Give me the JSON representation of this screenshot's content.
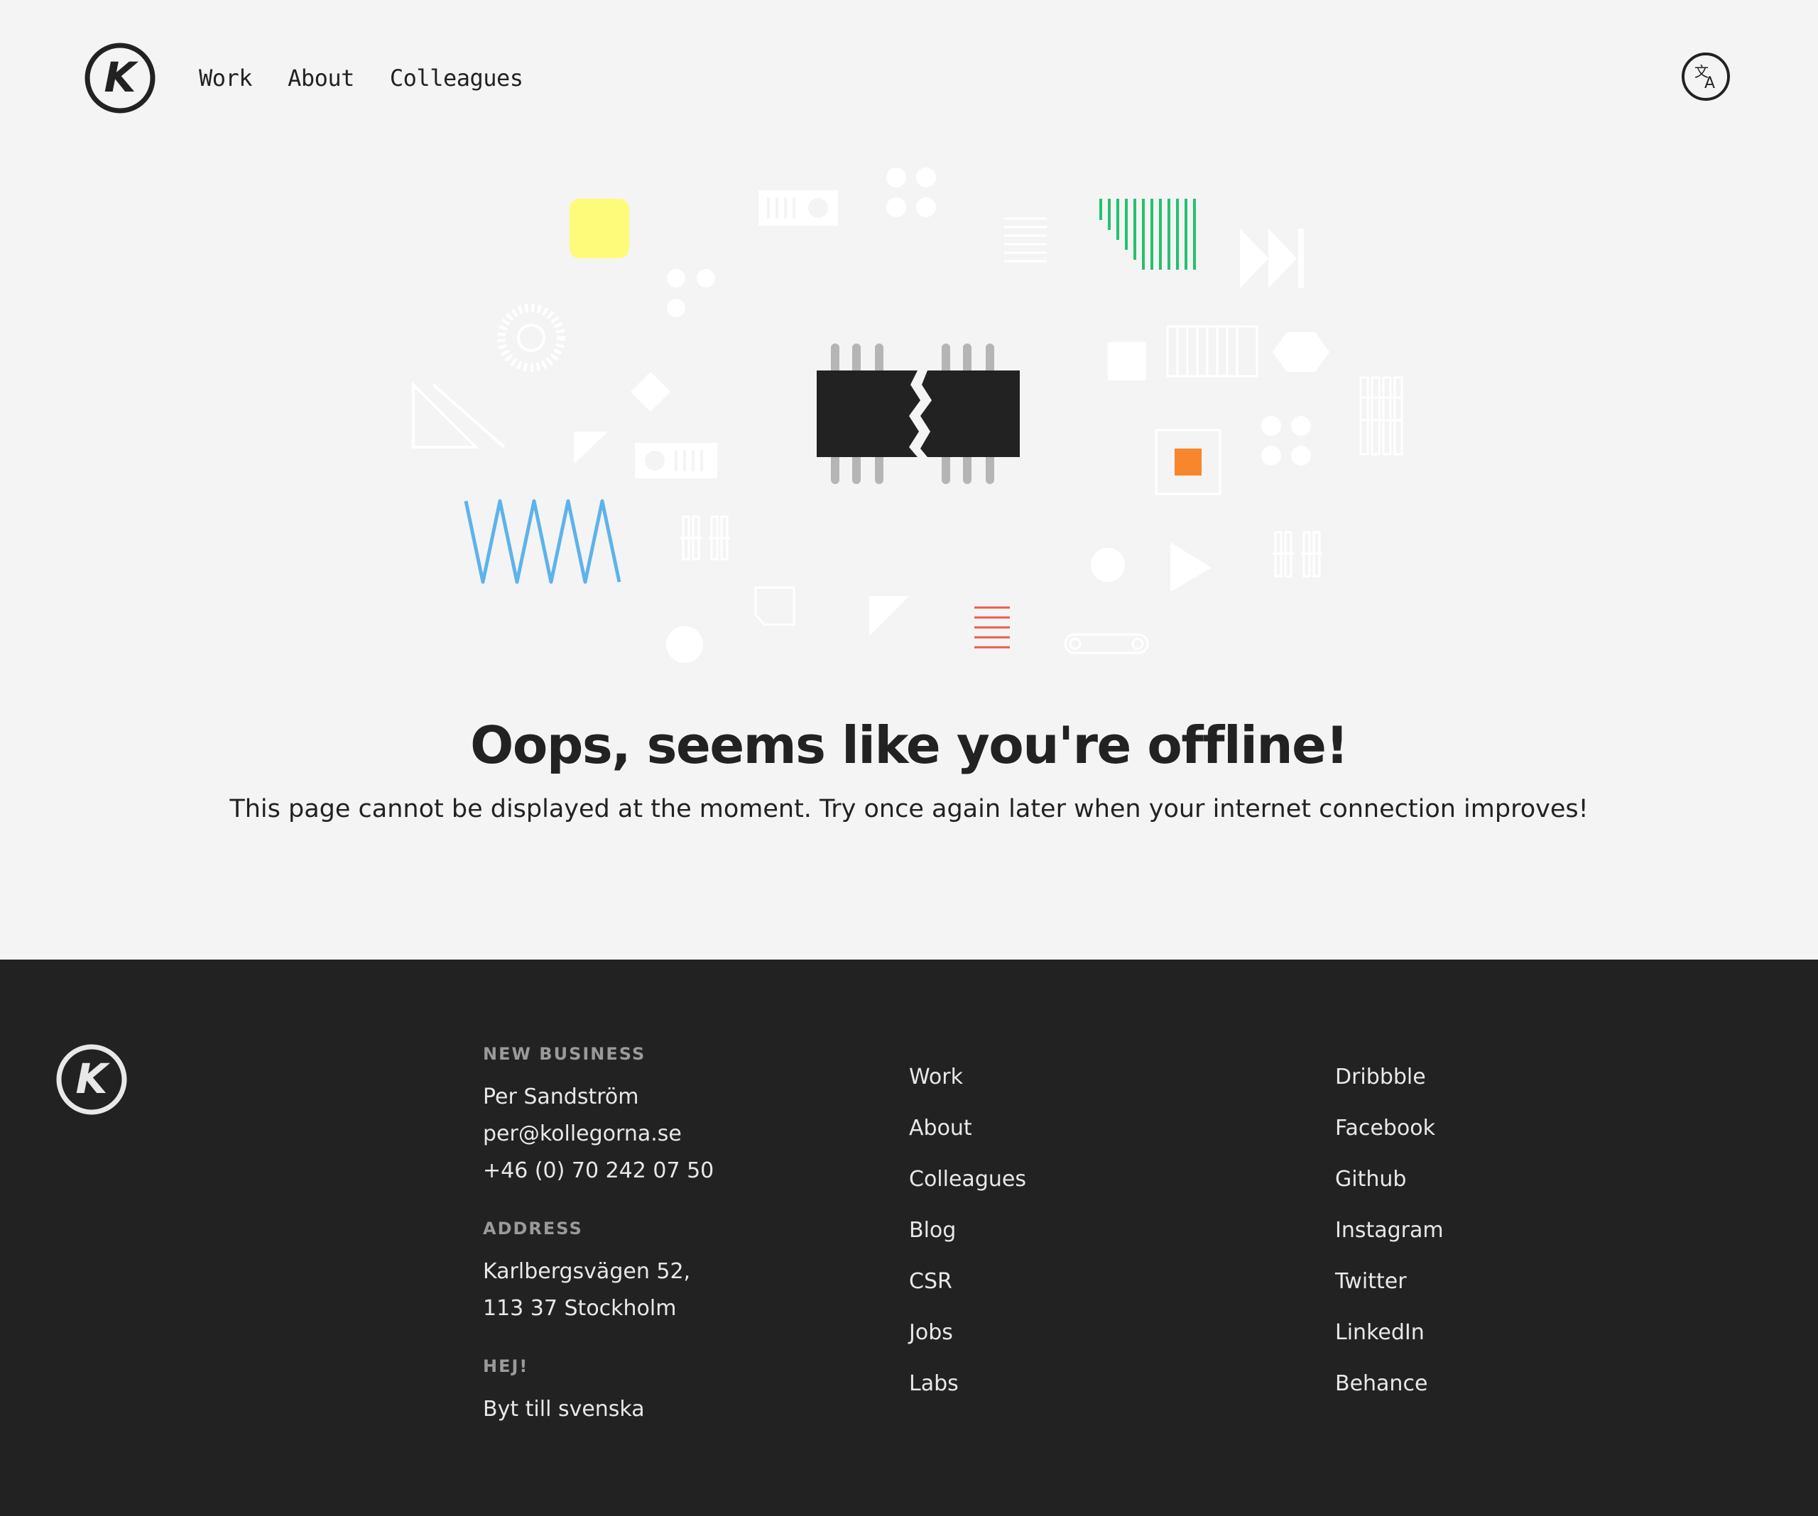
{
  "header": {
    "logo_letter": "K",
    "nav": [
      {
        "label": "Work"
      },
      {
        "label": "About"
      },
      {
        "label": "Colleagues"
      }
    ],
    "language_icon": "translate-icon"
  },
  "main": {
    "headline": "Oops, seems like you're offline!",
    "subline": "This page cannot be displayed at the moment. Try once again later when your internet connection improves!",
    "illustration_icon": "broken-chip-icon"
  },
  "footer": {
    "logo_letter": "K",
    "new_business": {
      "heading": "NEW BUSINESS",
      "name": "Per Sandström",
      "email": "per@kollegorna.se",
      "phone": "+46 (0) 70 242 07 50"
    },
    "address": {
      "heading": "ADDRESS",
      "line1": "Karlbergsvägen 52,",
      "line2": "113 37 Stockholm"
    },
    "hej": {
      "heading": "HEJ!",
      "link": "Byt till svenska"
    },
    "site_links": [
      "Work",
      "About",
      "Colleagues",
      "Blog",
      "CSR",
      "Jobs",
      "Labs"
    ],
    "social_links": [
      "Dribbble",
      "Facebook",
      "Github",
      "Instagram",
      "Twitter",
      "LinkedIn",
      "Behance"
    ]
  },
  "colors": {
    "background": "#f4f4f4",
    "footer_background": "#222222",
    "text": "#222222",
    "accent_yellow": "#fffb7a",
    "accent_green": "#22c26e",
    "accent_blue": "#5db3ea",
    "accent_orange": "#f7862c",
    "accent_red": "#ee5a4a"
  }
}
